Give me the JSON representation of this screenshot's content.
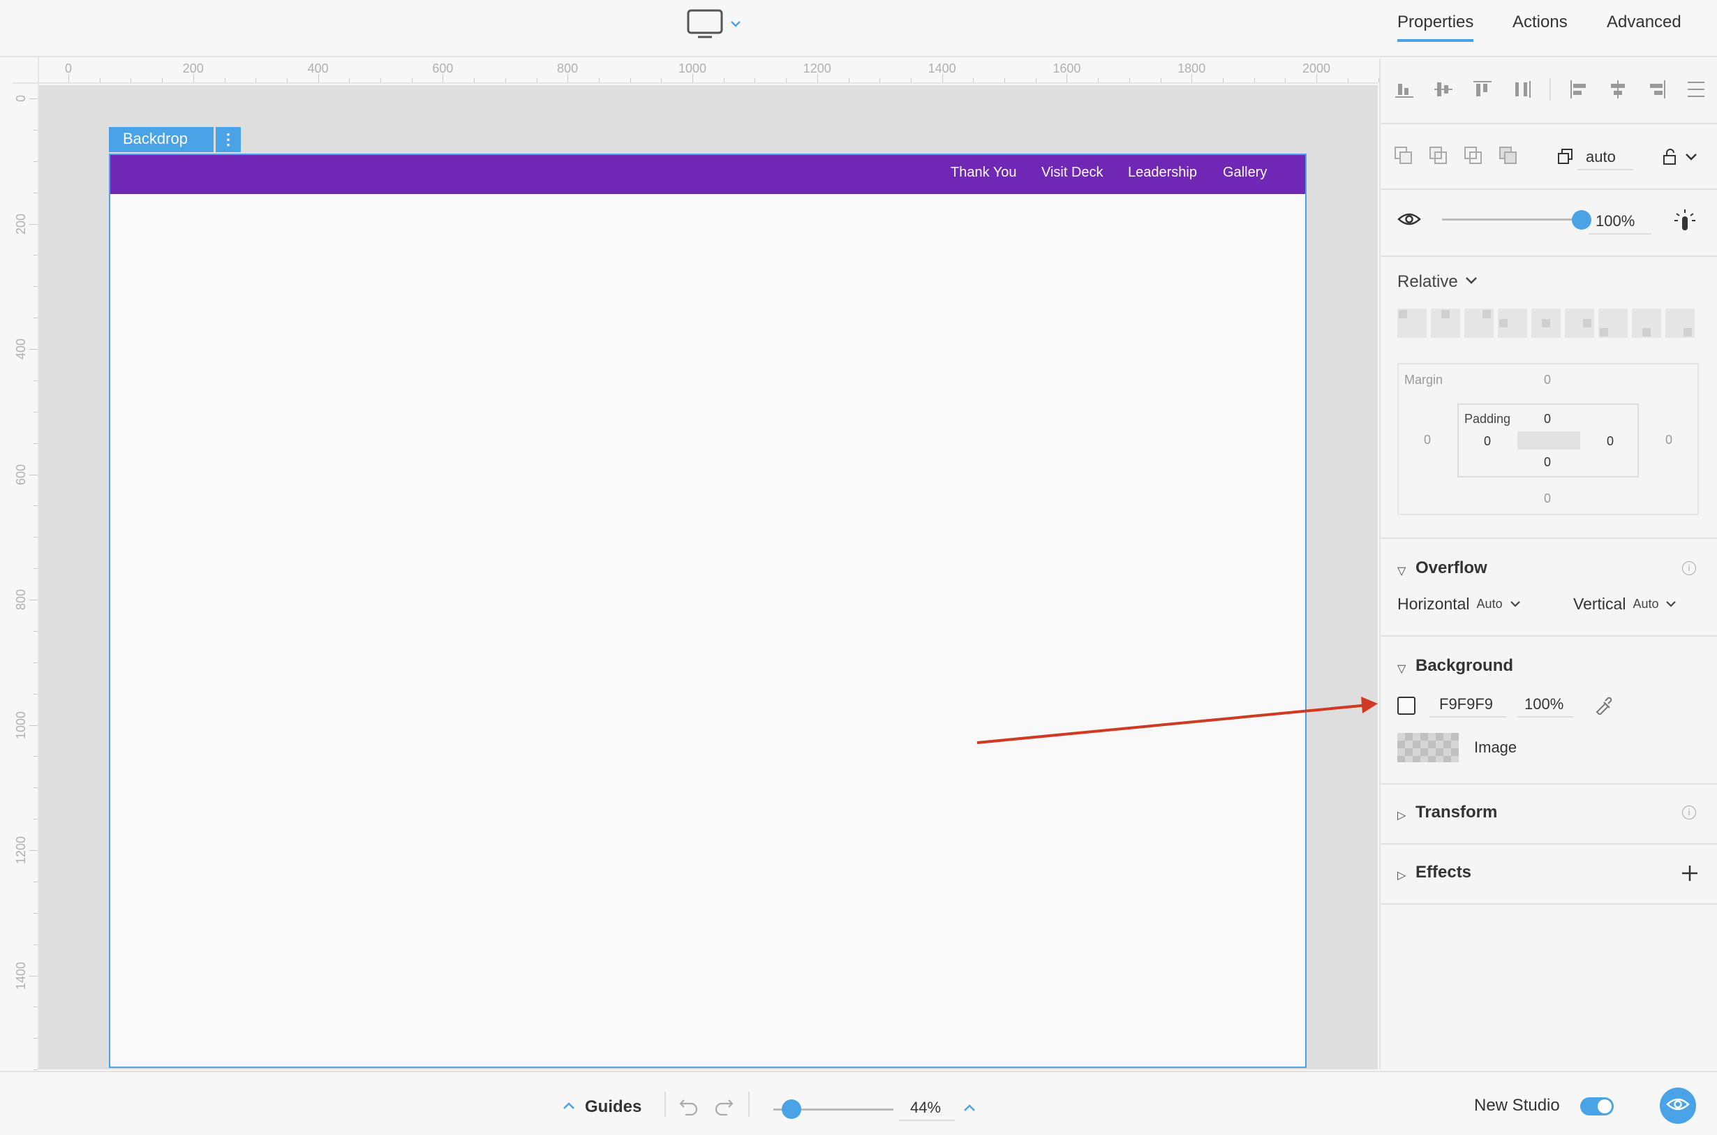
{
  "topbar": {
    "device_icon": "monitor-icon",
    "tabs": [
      {
        "label": "Properties",
        "active": true
      },
      {
        "label": "Actions",
        "active": false
      },
      {
        "label": "Advanced",
        "active": false
      }
    ]
  },
  "ruler": {
    "horizontal_labels": [
      "0",
      "200",
      "400",
      "600",
      "800",
      "1000",
      "1200",
      "1400",
      "1600",
      "1800",
      "2000"
    ],
    "vertical_labels": [
      "0",
      "200",
      "400",
      "600",
      "800",
      "1000",
      "1200",
      "1400"
    ]
  },
  "canvas": {
    "element_label": "Backdrop",
    "nav_links": [
      "Thank You",
      "Visit Deck",
      "Leadership",
      "Gallery"
    ],
    "nav_color": "#7027b6",
    "selection_color": "#4aa3e6",
    "arrow_color": "#d13a22"
  },
  "panel": {
    "layer_order_value": "auto",
    "opacity_value": "100%",
    "opacity_fraction": 1.0,
    "position_mode": "Relative",
    "spacing": {
      "margin_label": "Margin",
      "margin_top": "0",
      "margin_left": "0",
      "margin_right": "0",
      "margin_bottom": "0",
      "padding_label": "Padding",
      "padding_top": "0",
      "padding_left": "0",
      "padding_right": "0",
      "padding_bottom": "0"
    },
    "overflow": {
      "title": "Overflow",
      "horizontal_label": "Horizontal",
      "horizontal_value": "Auto",
      "vertical_label": "Vertical",
      "vertical_value": "Auto"
    },
    "background": {
      "title": "Background",
      "color_hex": "F9F9F9",
      "opacity": "100%",
      "image_label": "Image"
    },
    "transform": {
      "title": "Transform"
    },
    "effects": {
      "title": "Effects"
    }
  },
  "bottombar": {
    "guides_label": "Guides",
    "zoom_value": "44%",
    "zoom_fraction": 0.15,
    "new_studio_label": "New Studio",
    "new_studio_on": true
  }
}
